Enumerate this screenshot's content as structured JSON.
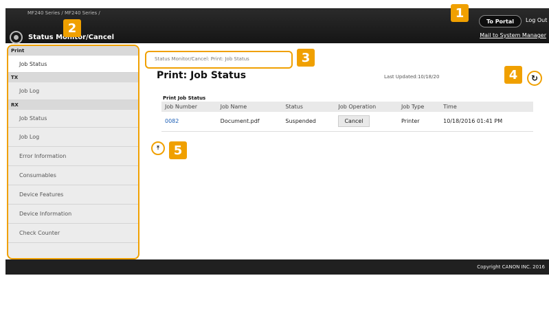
{
  "header": {
    "breadcrumb_text": "MF240 Series / MF240 Series /",
    "app_title": "Status Monitor/Cancel",
    "to_portal_label": "To Portal",
    "log_out_label": "Log Out",
    "mail_link": "Mail to System Manager"
  },
  "sidebar": {
    "groups": [
      {
        "label": "Print",
        "items": [
          "Job Status"
        ]
      },
      {
        "label": "TX",
        "items": [
          "Job Log"
        ]
      },
      {
        "label": "RX",
        "items": [
          "Job Status",
          "Job Log"
        ]
      }
    ],
    "items": [
      "Error Information",
      "Consumables",
      "Device Features",
      "Device Information",
      "Check Counter"
    ]
  },
  "main": {
    "breadcrumb": "Status Monitor/Cancel: Print: Job Status",
    "title": "Print: Job Status",
    "last_updated": "Last Updated:10/18/20",
    "table_title": "Print Job Status",
    "columns": [
      "Job Number",
      "Job Name",
      "Status",
      "Job Operation",
      "Job Type",
      "Time"
    ],
    "rows": [
      {
        "job_number": "0082",
        "job_name": "Document.pdf",
        "status": "Suspended",
        "operation": "Cancel",
        "job_type": "Printer",
        "time": "10/18/2016 01:41 PM"
      }
    ]
  },
  "footer": {
    "copyright": "Copyright CANON INC. 2016"
  },
  "callouts": [
    "1",
    "2",
    "3",
    "4",
    "5"
  ],
  "colors": {
    "accent": "#f0a000",
    "header_bg": "#1b1b1b",
    "link": "#1c5fb6"
  }
}
